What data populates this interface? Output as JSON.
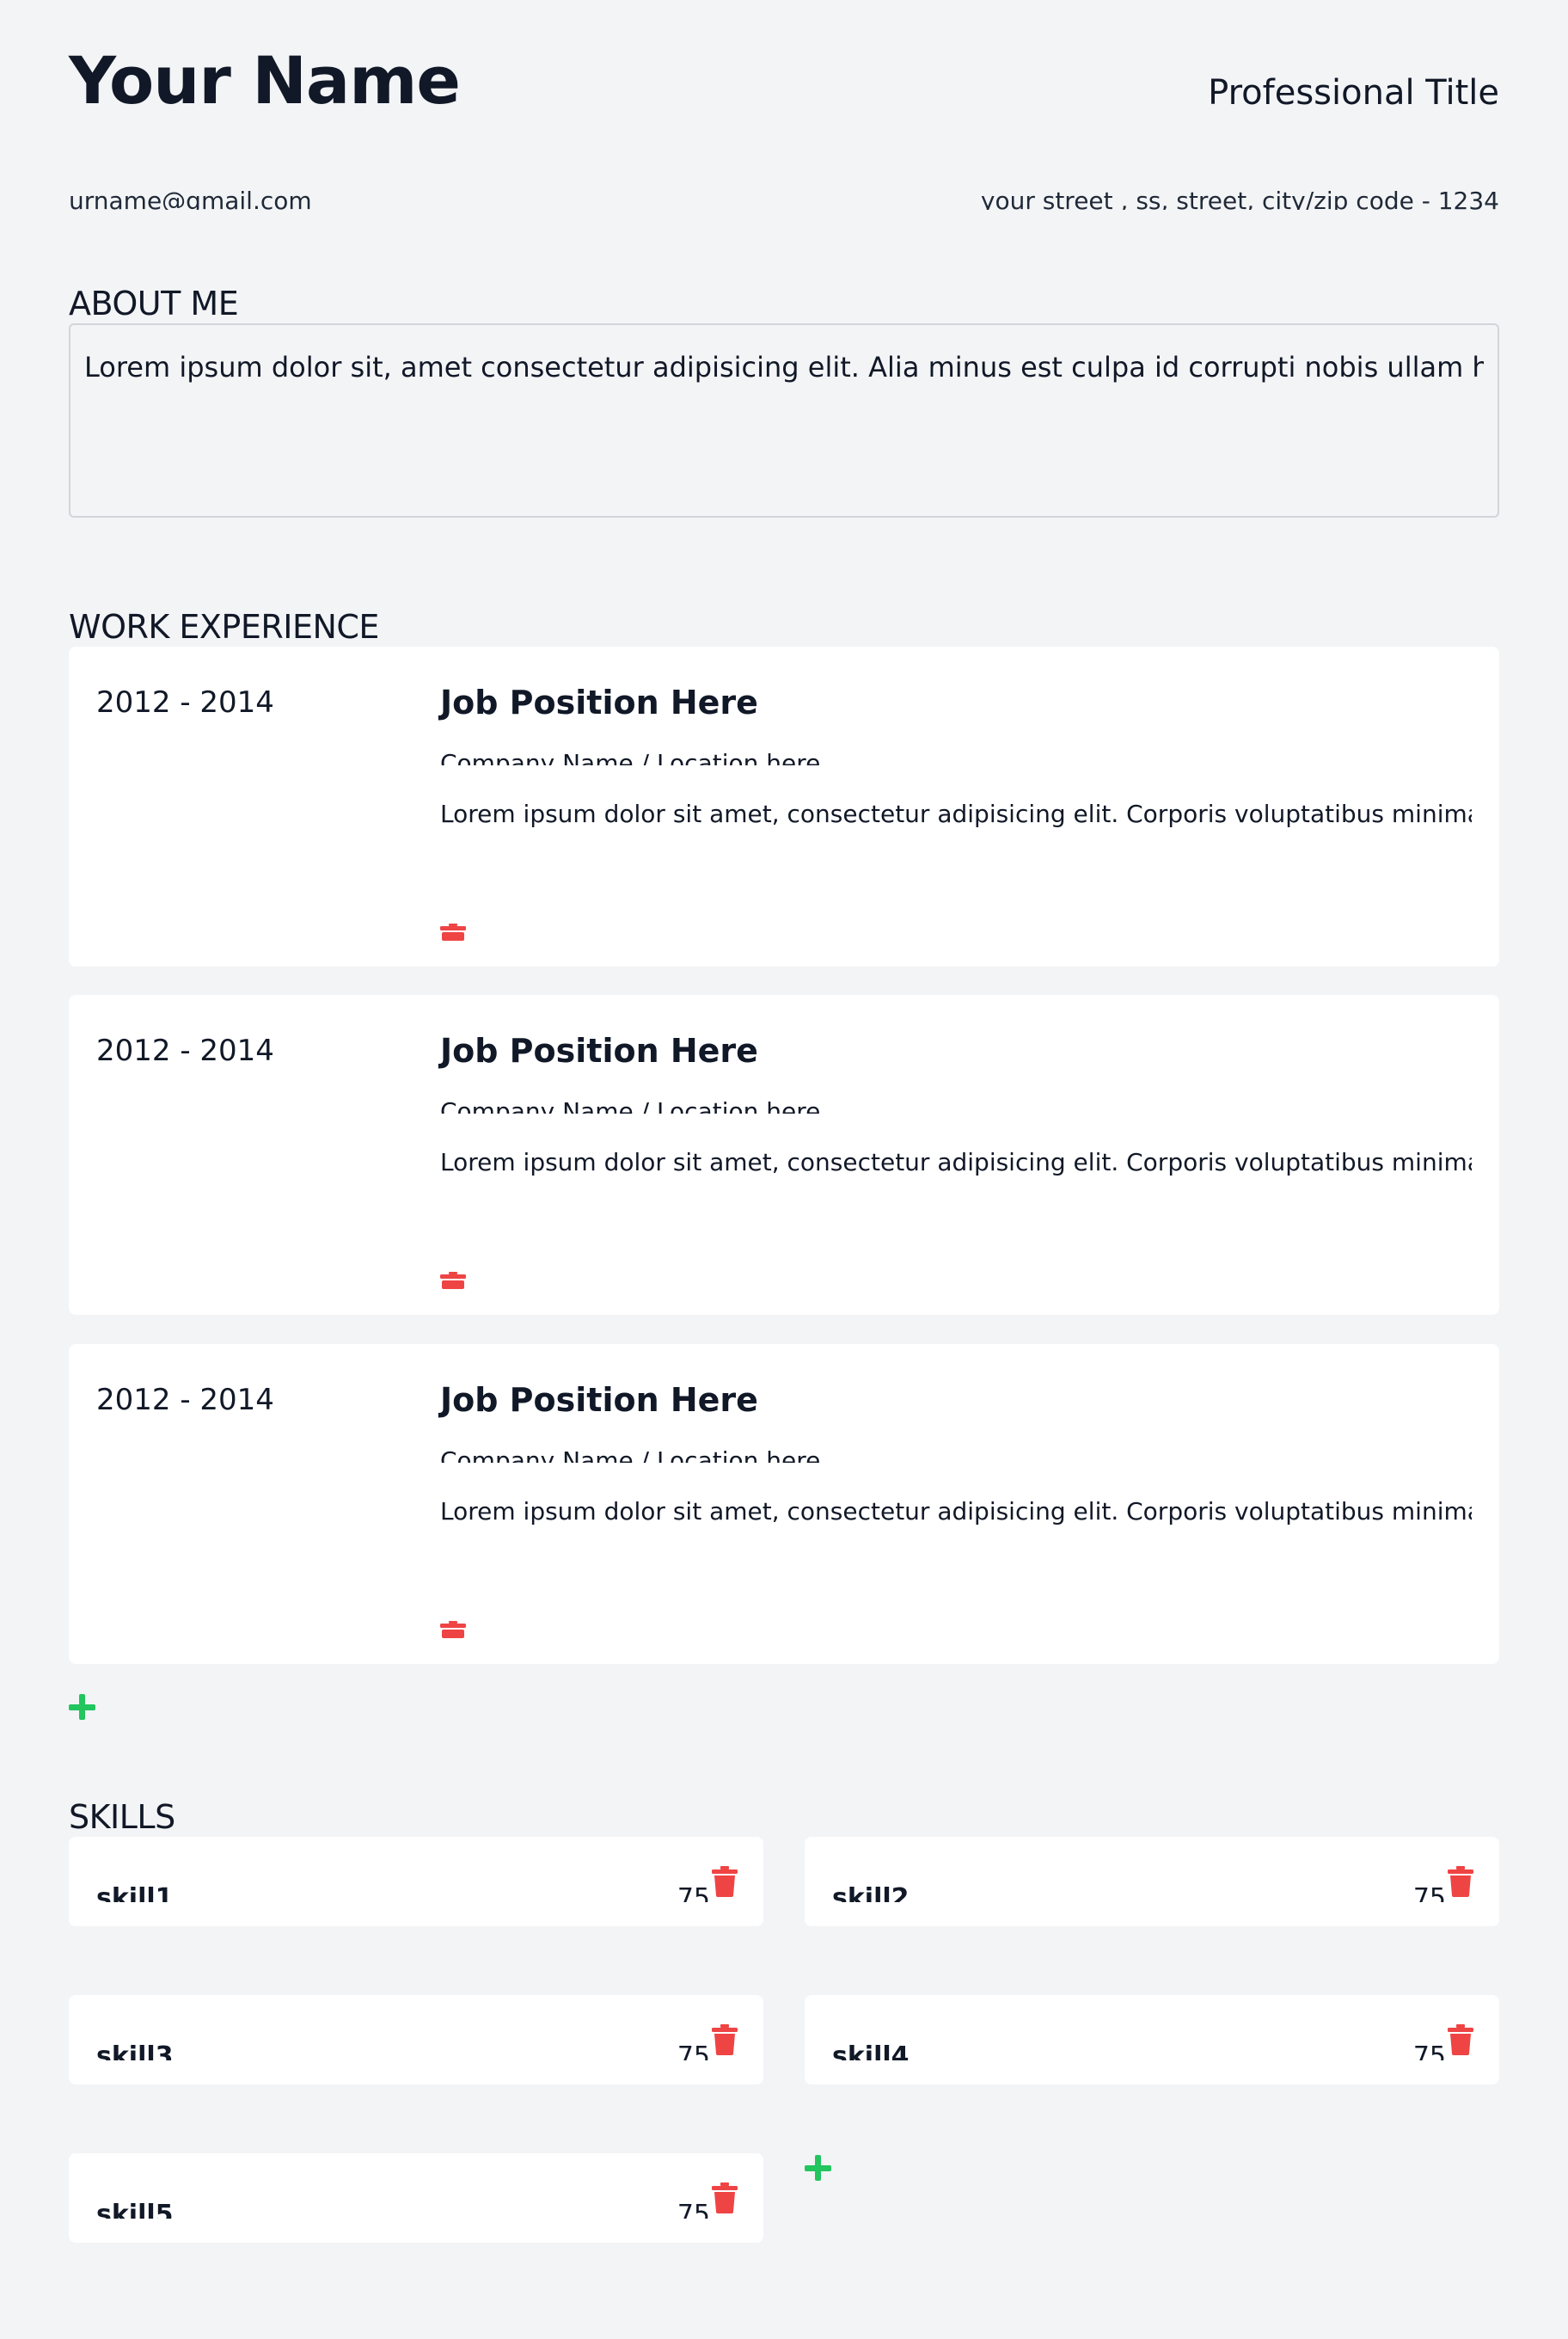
{
  "header": {
    "name": "Your Name",
    "professional_title": "Professional Title",
    "email": "urname@gmail.com",
    "address": "your street , ss, street, city/zip code - 1234"
  },
  "about": {
    "heading": "ABOUT ME",
    "text": "Lorem ipsum dolor sit, amet consectetur adipisicing elit. Alia minus est culpa id corrupti nobis ullam harum"
  },
  "work": {
    "heading": "WORK EXPERIENCE",
    "items": [
      {
        "dates": "2012 - 2014",
        "position": "Job Position Here",
        "company": "Company Name / Location here",
        "description": "Lorem ipsum dolor sit amet, consectetur adipisicing elit. Corporis voluptatibus minima tenetur"
      },
      {
        "dates": "2012 - 2014",
        "position": "Job Position Here",
        "company": "Company Name / Location here",
        "description": "Lorem ipsum dolor sit amet, consectetur adipisicing elit. Corporis voluptatibus minima tenetur"
      },
      {
        "dates": "2012 - 2014",
        "position": "Job Position Here",
        "company": "Company Name / Location here",
        "description": "Lorem ipsum dolor sit amet, consectetur adipisicing elit. Corporis voluptatibus minima tenetur"
      }
    ],
    "delete_icon": "trash-icon",
    "add_icon": "plus-icon"
  },
  "skills": {
    "heading": "SKILLS",
    "items": [
      {
        "name": "skill1",
        "level": "75"
      },
      {
        "name": "skill2",
        "level": "75"
      },
      {
        "name": "skill3",
        "level": "75"
      },
      {
        "name": "skill4",
        "level": "75"
      },
      {
        "name": "skill5",
        "level": "75"
      }
    ],
    "delete_icon": "trash-icon",
    "add_icon": "plus-icon"
  },
  "colors": {
    "background": "#f3f4f6",
    "card": "#ffffff",
    "text": "#111827",
    "delete": "#ef4444",
    "add": "#22c55e"
  }
}
